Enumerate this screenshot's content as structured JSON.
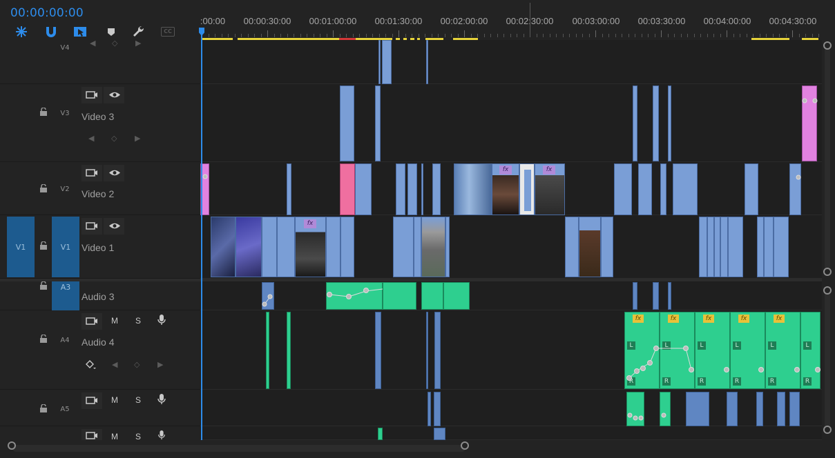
{
  "timecode": "00:00:00:00",
  "toolbar": {
    "tools": [
      {
        "name": "snap-nest-icon",
        "label": ""
      },
      {
        "name": "magnet-icon",
        "label": ""
      },
      {
        "name": "linked-selection-icon",
        "label": ""
      },
      {
        "name": "marker-icon",
        "label": ""
      },
      {
        "name": "wrench-icon",
        "label": ""
      },
      {
        "name": "captions-icon",
        "label": "CC"
      }
    ]
  },
  "ruler": {
    "labels": [
      ":00:00",
      "00:00:30:00",
      "00:01:00:00",
      "00:01:30:00",
      "00:02:00:00",
      "00:02:30:00",
      "00:03:00:00",
      "00:03:30:00",
      "00:04:00:00",
      "00:04:30:00"
    ]
  },
  "tracks": {
    "v4": {
      "id": "V4"
    },
    "v3": {
      "id": "V3",
      "name": "Video 3"
    },
    "v2": {
      "id": "V2",
      "name": "Video 2"
    },
    "v1": {
      "id": "V1",
      "name": "Video 1",
      "source": "V1"
    },
    "a3": {
      "id": "A3",
      "name": "Audio 3"
    },
    "a4": {
      "id": "A4",
      "name": "Audio 4",
      "mute": "M",
      "solo": "S"
    },
    "a5": {
      "id": "A5",
      "mute": "M",
      "solo": "S"
    },
    "a6": {
      "mute": "M",
      "solo": "S"
    }
  },
  "fx": "fx",
  "channel": {
    "left": "L",
    "right": "R"
  },
  "colors": {
    "accent": "#2d8ceb",
    "video_clip": "#7a9ed6",
    "audio_clip": "#2ecf8f",
    "pink_clip": "#e182e0",
    "render_yellow": "#e6d33a",
    "render_red": "#d43838"
  }
}
